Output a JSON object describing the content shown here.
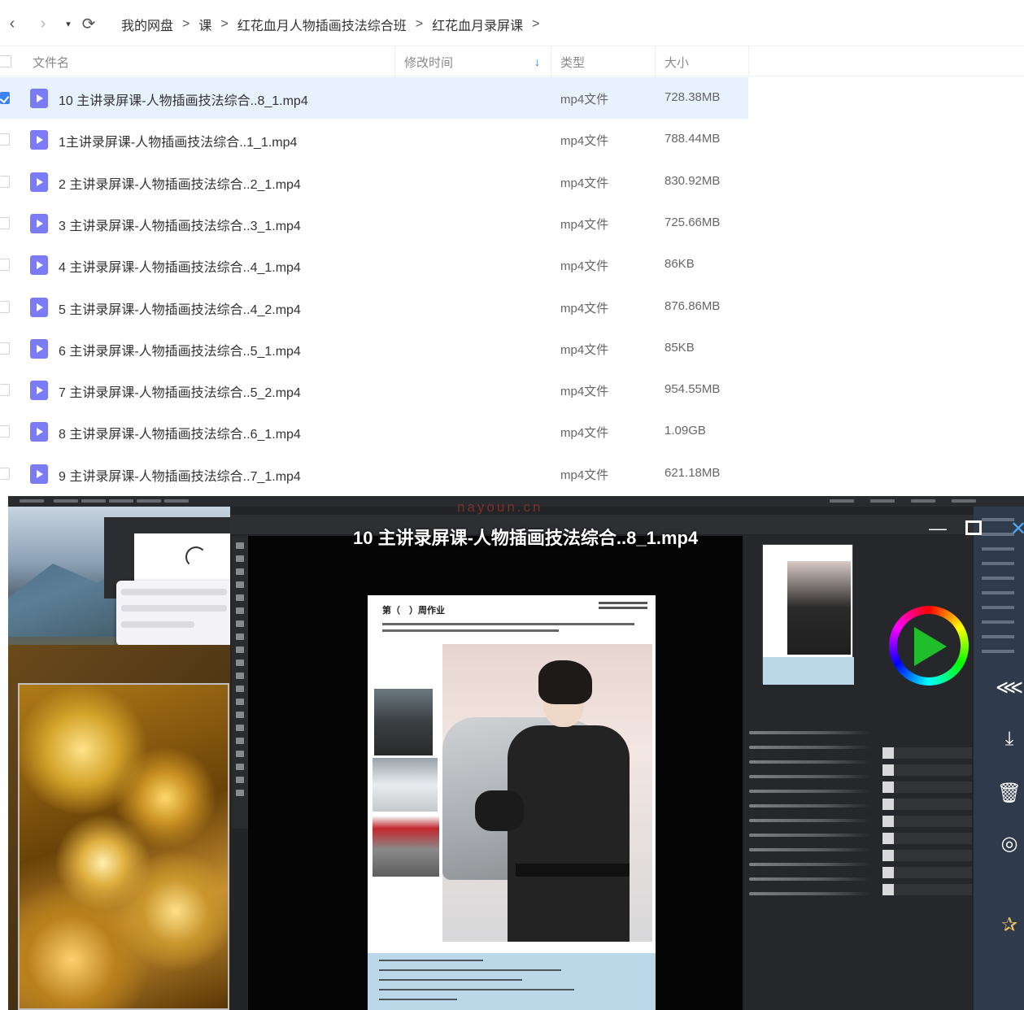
{
  "nav": {
    "back_icon": "‹",
    "forward_icon": "›",
    "dropdown_icon": "▾",
    "refresh_icon": "⟳",
    "breadcrumb": [
      "我的网盘",
      "课",
      "红花血月人物插画技法综合班",
      "红花血月录屏课"
    ],
    "separator": ">"
  },
  "table": {
    "headers": {
      "name": "文件名",
      "modified": "修改时间",
      "type": "类型",
      "size": "大小",
      "sort_icon": "↓"
    },
    "rows": [
      {
        "name": "10 主讲录屏课-人物插画技法综合..8_1.mp4",
        "type": "mp4文件",
        "size": "728.38MB",
        "selected": true
      },
      {
        "name": "1主讲录屏课-人物插画技法综合..1_1.mp4",
        "type": "mp4文件",
        "size": "788.44MB",
        "selected": false
      },
      {
        "name": "2 主讲录屏课-人物插画技法综合..2_1.mp4",
        "type": "mp4文件",
        "size": "830.92MB",
        "selected": false
      },
      {
        "name": "3 主讲录屏课-人物插画技法综合..3_1.mp4",
        "type": "mp4文件",
        "size": "725.66MB",
        "selected": false
      },
      {
        "name": "4 主讲录屏课-人物插画技法综合..4_1.mp4",
        "type": "mp4文件",
        "size": "86KB",
        "selected": false
      },
      {
        "name": "5 主讲录屏课-人物插画技法综合..4_2.mp4",
        "type": "mp4文件",
        "size": "876.86MB",
        "selected": false
      },
      {
        "name": "6 主讲录屏课-人物插画技法综合..5_1.mp4",
        "type": "mp4文件",
        "size": "85KB",
        "selected": false
      },
      {
        "name": "7 主讲录屏课-人物插画技法综合..5_2.mp4",
        "type": "mp4文件",
        "size": "954.55MB",
        "selected": false
      },
      {
        "name": "8 主讲录屏课-人物插画技法综合..6_1.mp4",
        "type": "mp4文件",
        "size": "1.09GB",
        "selected": false
      },
      {
        "name": "9 主讲录屏课-人物插画技法综合..7_1.mp4",
        "type": "mp4文件",
        "size": "621.18MB",
        "selected": false
      }
    ]
  },
  "preview": {
    "title": "10 主讲录屏课-人物插画技法综合..8_1.mp4",
    "watermark": "nayoun.cn",
    "doc_heading": "第（　）周作业",
    "controls": {
      "minimize_icon": "—",
      "close_icon": "✕",
      "share_icon": "⋘",
      "download_icon": "⤓",
      "delete_icon": "🗑",
      "settings_icon": "◎",
      "pin_icon": "✰"
    }
  },
  "colors": {
    "selected_row": "#e8f1fe",
    "accent": "#2f7bf5",
    "file_icon": "#7b7bf5"
  }
}
